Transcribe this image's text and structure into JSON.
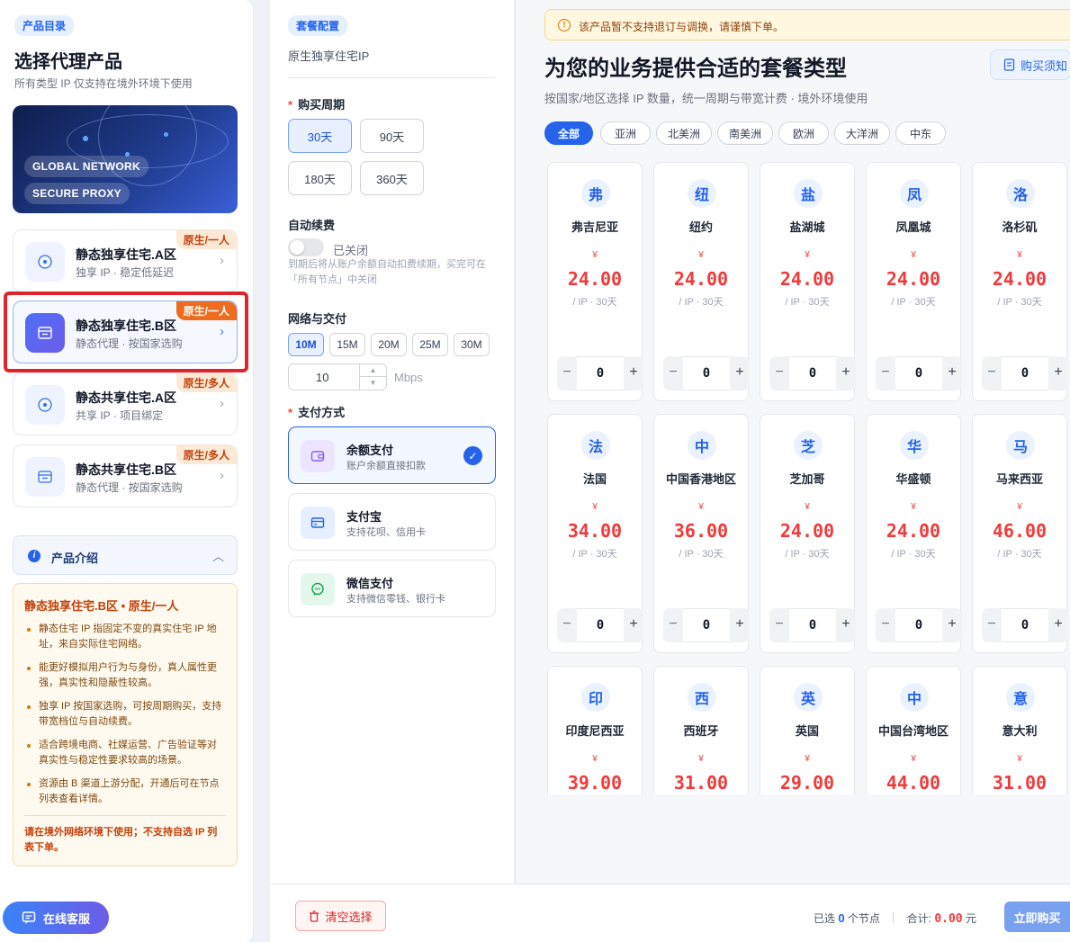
{
  "sidebar": {
    "tag": "产品目录",
    "title": "选择代理产品",
    "subtitle": "所有类型 IP 仅支持在境外环境下使用",
    "banner": [
      "GLOBAL NETWORK",
      "SECURE PROXY"
    ],
    "products": [
      {
        "name": "静态独享住宅.A区",
        "desc": "独享 IP · 稳定低延迟",
        "badge": "原生/一人",
        "selected": false
      },
      {
        "name": "静态独享住宅.B区",
        "desc": "静态代理 · 按国家选购",
        "badge": "原生/一人",
        "selected": true
      },
      {
        "name": "静态共享住宅.A区",
        "desc": "共享 IP · 项目绑定",
        "badge": "原生/多人",
        "selected": false
      },
      {
        "name": "静态共享住宅.B区",
        "desc": "静态代理 · 按国家选购",
        "badge": "原生/多人",
        "selected": false
      }
    ],
    "intro": {
      "header": "产品介绍",
      "title": "静态独享住宅.B区 • 原生/一人",
      "bullets": [
        "静态住宅 IP 指固定不变的真实住宅 IP 地址，来自实际住宅网络。",
        "能更好模拟用户行为与身份，真人属性更强，真实性和隐蔽性较高。",
        "独享 IP 按国家选购，可按周期购买，支持带宽档位与自动续费。",
        "适合跨境电商、社媒运营、广告验证等对真实性与稳定性要求较高的场景。",
        "资源由 B 渠道上游分配，开通后可在节点列表查看详情。"
      ],
      "warning": "请在境外网络环境下使用；不支持自选 IP 列表下单。"
    },
    "service_label": "在线客服"
  },
  "config": {
    "tag": "套餐配置",
    "product_name": "原生独享住宅IP",
    "period_label": "购买周期",
    "periods": [
      "30天",
      "90天",
      "180天",
      "360天"
    ],
    "period_selected": "30天",
    "auto_renew_label": "自动续费",
    "auto_renew_state": "已关闭",
    "auto_renew_note": "到期后将从账户余额自动扣费续期，买完可在「所有节点」中关闭",
    "network_label": "网络与交付",
    "bandwidths": [
      "10M",
      "15M",
      "20M",
      "25M",
      "30M"
    ],
    "bandwidth_selected": "10M",
    "bandwidth_value": "10",
    "bandwidth_unit": "Mbps",
    "payment_label": "支付方式",
    "payments": [
      {
        "name": "余额支付",
        "desc": "账户余额直接扣款",
        "selected": true,
        "icon": "wallet-icon"
      },
      {
        "name": "支付宝",
        "desc": "支持花呗、信用卡",
        "selected": false,
        "icon": "card-icon"
      },
      {
        "name": "微信支付",
        "desc": "支持微信零钱、银行卡",
        "selected": false,
        "icon": "wechat-icon"
      }
    ]
  },
  "main": {
    "notice": "该产品暂不支持退订与调换，请谨慎下单。",
    "title": "为您的业务提供合适的套餐类型",
    "buy_info": "购买须知",
    "subtitle": "按国家/地区选择 IP 数量，统一周期与带宽计费 · 境外环境使用",
    "regions": [
      "全部",
      "亚洲",
      "北美洲",
      "南美洲",
      "欧洲",
      "大洋洲",
      "中东"
    ],
    "region_selected": "全部",
    "currency": "¥",
    "price_unit": "/ IP · 30天",
    "countries": [
      {
        "initial": "弗",
        "name": "弗吉尼亚",
        "price": "24.00",
        "qty": "0"
      },
      {
        "initial": "纽",
        "name": "纽约",
        "price": "24.00",
        "qty": "0"
      },
      {
        "initial": "盐",
        "name": "盐湖城",
        "price": "24.00",
        "qty": "0"
      },
      {
        "initial": "凤",
        "name": "凤凰城",
        "price": "24.00",
        "qty": "0"
      },
      {
        "initial": "洛",
        "name": "洛杉矶",
        "price": "24.00",
        "qty": "0"
      },
      {
        "initial": "法",
        "name": "法国",
        "price": "34.00",
        "qty": "0"
      },
      {
        "initial": "中",
        "name": "中国香港地区",
        "price": "36.00",
        "qty": "0"
      },
      {
        "initial": "芝",
        "name": "芝加哥",
        "price": "24.00",
        "qty": "0"
      },
      {
        "initial": "华",
        "name": "华盛顿",
        "price": "24.00",
        "qty": "0"
      },
      {
        "initial": "马",
        "name": "马来西亚",
        "price": "46.00",
        "qty": "0"
      },
      {
        "initial": "印",
        "name": "印度尼西亚",
        "price": "39.00",
        "qty": "0"
      },
      {
        "initial": "西",
        "name": "西班牙",
        "price": "31.00",
        "qty": "0"
      },
      {
        "initial": "英",
        "name": "英国",
        "price": "29.00",
        "qty": "0"
      },
      {
        "initial": "中",
        "name": "中国台湾地区",
        "price": "44.00",
        "qty": "0"
      },
      {
        "initial": "意",
        "name": "意大利",
        "price": "31.00",
        "qty": "0"
      }
    ]
  },
  "footer": {
    "clear_label": "清空选择",
    "selected_prefix": "已选",
    "selected_count": "0",
    "selected_suffix": "个节点",
    "total_label": "合计:",
    "total_amount": "0.00",
    "total_unit": "元",
    "buy_label": "立即购买"
  }
}
